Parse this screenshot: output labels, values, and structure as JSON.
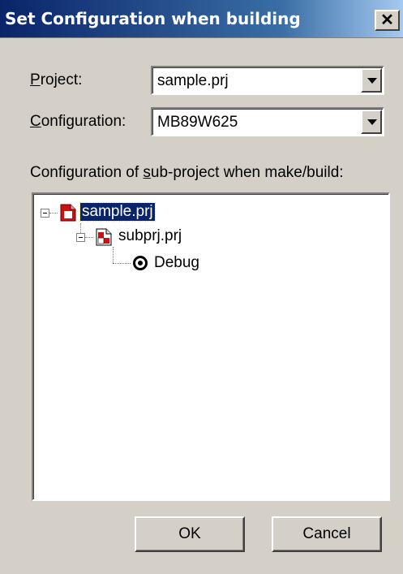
{
  "dialog": {
    "title": "Set Configuration when building",
    "close_glyph": "✕"
  },
  "project": {
    "label_mnemonic": "P",
    "label_rest": "roject:",
    "value": "sample.prj"
  },
  "configuration": {
    "label_mnemonic": "C",
    "label_rest": "onfiguration:",
    "value": "MB89W625"
  },
  "subproject": {
    "label_pre": "Configuration of ",
    "label_mnemonic": "s",
    "label_post": "ub-project when make/build:"
  },
  "tree": {
    "nodes": [
      {
        "label": "sample.prj",
        "icon": "project-file-icon",
        "selected": true
      },
      {
        "label": "subprj.prj",
        "icon": "subproject-file-icon",
        "selected": false
      },
      {
        "label": "Debug",
        "icon": "radio-selected-icon",
        "selected": false
      }
    ]
  },
  "buttons": {
    "ok_label": "OK",
    "cancel_label": "Cancel"
  },
  "colors": {
    "title_start": "#0a246a",
    "title_end": "#a6caf0",
    "face": "#d4d0c8",
    "selection": "#0a246a",
    "icon_red": "#d01010"
  }
}
